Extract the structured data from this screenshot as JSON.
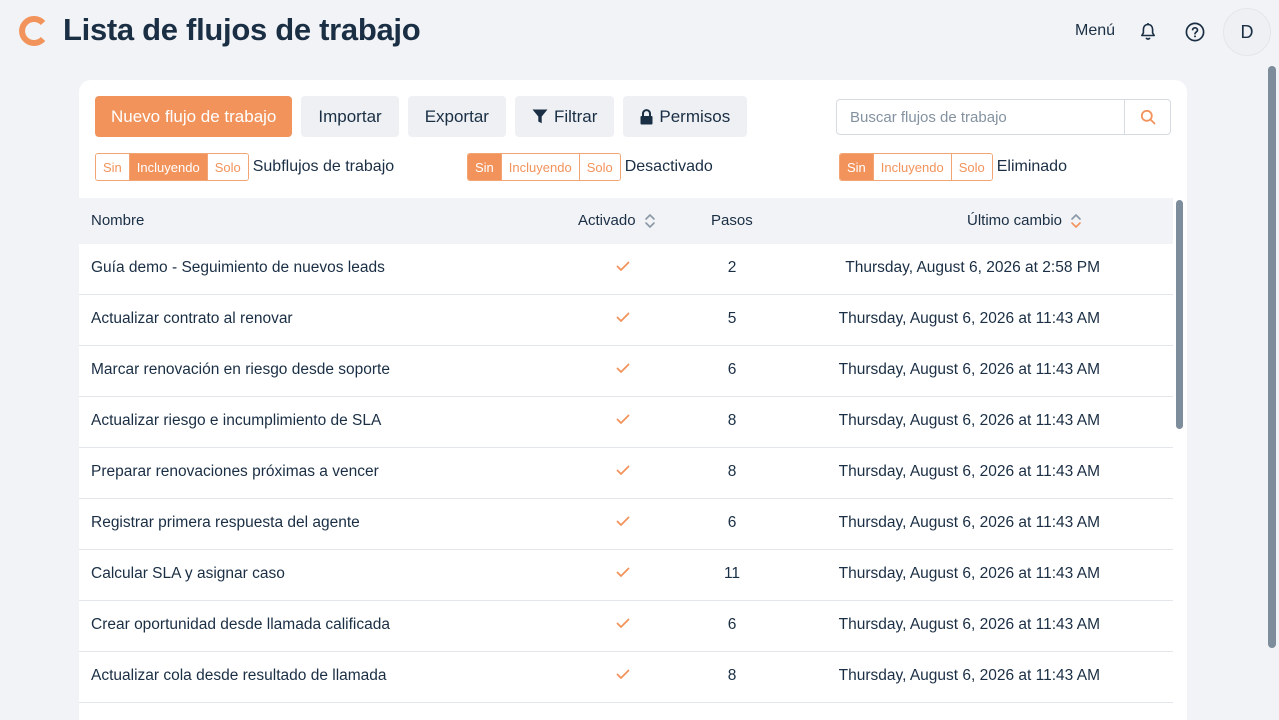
{
  "header": {
    "title": "Lista de flujos de trabajo",
    "menu_label": "Menú",
    "avatar_initial": "D",
    "logo_color": "#f2935c"
  },
  "toolbar": {
    "new_label": "Nuevo flujo de trabajo",
    "import_label": "Importar",
    "export_label": "Exportar",
    "filter_label": "Filtrar",
    "permissions_label": "Permisos"
  },
  "search": {
    "placeholder": "Buscar flujos de trabajo"
  },
  "filters": [
    {
      "label": "Subflujos de trabajo",
      "options": [
        "Sin",
        "Incluyendo",
        "Solo"
      ],
      "selected": "Incluyendo"
    },
    {
      "label": "Desactivado",
      "options": [
        "Sin",
        "Incluyendo",
        "Solo"
      ],
      "selected": "Sin"
    },
    {
      "label": "Eliminado",
      "options": [
        "Sin",
        "Incluyendo",
        "Solo"
      ],
      "selected": "Sin"
    }
  ],
  "table": {
    "columns": {
      "name": "Nombre",
      "enabled": "Activado",
      "steps": "Pasos",
      "changed": "Último cambio"
    },
    "rows": [
      {
        "name": "Guía demo - Seguimiento de nuevos leads",
        "enabled": true,
        "steps": "2",
        "changed": "Thursday, August 6, 2026 at 2:58 PM"
      },
      {
        "name": "Actualizar contrato al renovar",
        "enabled": true,
        "steps": "5",
        "changed": "Thursday, August 6, 2026 at 11:43 AM"
      },
      {
        "name": "Marcar renovación en riesgo desde soporte",
        "enabled": true,
        "steps": "6",
        "changed": "Thursday, August 6, 2026 at 11:43 AM"
      },
      {
        "name": "Actualizar riesgo e incumplimiento de SLA",
        "enabled": true,
        "steps": "8",
        "changed": "Thursday, August 6, 2026 at 11:43 AM"
      },
      {
        "name": "Preparar renovaciones próximas a vencer",
        "enabled": true,
        "steps": "8",
        "changed": "Thursday, August 6, 2026 at 11:43 AM"
      },
      {
        "name": "Registrar primera respuesta del agente",
        "enabled": true,
        "steps": "6",
        "changed": "Thursday, August 6, 2026 at 11:43 AM"
      },
      {
        "name": "Calcular SLA y asignar caso",
        "enabled": true,
        "steps": "11",
        "changed": "Thursday, August 6, 2026 at 11:43 AM"
      },
      {
        "name": "Crear oportunidad desde llamada calificada",
        "enabled": true,
        "steps": "6",
        "changed": "Thursday, August 6, 2026 at 11:43 AM"
      },
      {
        "name": "Actualizar cola desde resultado de llamada",
        "enabled": true,
        "steps": "8",
        "changed": "Thursday, August 6, 2026 at 11:43 AM"
      },
      {
        "name": "",
        "enabled": true,
        "steps": "",
        "changed": ""
      }
    ]
  }
}
